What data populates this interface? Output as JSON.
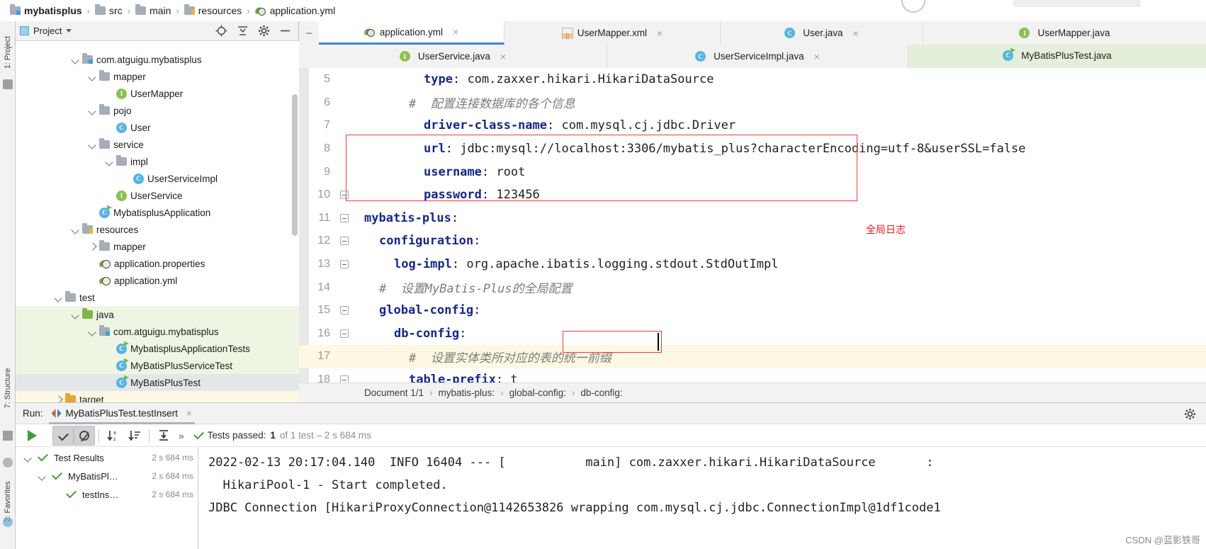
{
  "breadcrumb": {
    "items": [
      {
        "label": "mybatisplus",
        "icon": "module-folder-icon"
      },
      {
        "label": "src",
        "icon": "folder-icon"
      },
      {
        "label": "main",
        "icon": "folder-icon"
      },
      {
        "label": "resources",
        "icon": "resources-folder-icon"
      },
      {
        "label": "application.yml",
        "icon": "yaml-file-icon"
      }
    ],
    "separator": "›"
  },
  "project_panel": {
    "title": "Project",
    "actions": [
      "locate-icon",
      "collapse-all-icon",
      "gear-icon",
      "hide-icon"
    ],
    "tree": [
      {
        "label": "com.atguigu.mybatisplus",
        "icon": "package-icon",
        "indent": 3,
        "arrow": "down",
        "bg": "none"
      },
      {
        "label": "mapper",
        "icon": "folder-icon",
        "indent": 4,
        "arrow": "down",
        "bg": "none"
      },
      {
        "label": "UserMapper",
        "icon": "interface-icon",
        "indent": 5,
        "arrow": "none",
        "bg": "none"
      },
      {
        "label": "pojo",
        "icon": "folder-icon",
        "indent": 4,
        "arrow": "down",
        "bg": "none"
      },
      {
        "label": "User",
        "icon": "class-icon",
        "indent": 5,
        "arrow": "none",
        "bg": "none"
      },
      {
        "label": "service",
        "icon": "folder-icon",
        "indent": 4,
        "arrow": "down",
        "bg": "none"
      },
      {
        "label": "impl",
        "icon": "folder-icon",
        "indent": 5,
        "arrow": "down",
        "bg": "none"
      },
      {
        "label": "UserServiceImpl",
        "icon": "class-icon",
        "indent": 6,
        "arrow": "none",
        "bg": "none"
      },
      {
        "label": "UserService",
        "icon": "interface-icon",
        "indent": 5,
        "arrow": "none",
        "bg": "none"
      },
      {
        "label": "MybatisplusApplication",
        "icon": "runnable-class-icon",
        "indent": 4,
        "arrow": "none",
        "bg": "none"
      },
      {
        "label": "resources",
        "icon": "resources-folder-icon",
        "indent": 3,
        "arrow": "down",
        "bg": "none"
      },
      {
        "label": "mapper",
        "icon": "folder-icon",
        "indent": 4,
        "arrow": "right",
        "bg": "none"
      },
      {
        "label": "application.properties",
        "icon": "yaml-file-icon",
        "indent": 4,
        "arrow": "none",
        "bg": "none"
      },
      {
        "label": "application.yml",
        "icon": "yaml-file-icon",
        "indent": 4,
        "arrow": "none",
        "bg": "none"
      },
      {
        "label": "test",
        "icon": "folder-icon",
        "indent": 2,
        "arrow": "down",
        "bg": "none"
      },
      {
        "label": "java",
        "icon": "test-source-folder-icon",
        "indent": 3,
        "arrow": "down",
        "bg": "green"
      },
      {
        "label": "com.atguigu.mybatisplus",
        "icon": "package-icon",
        "indent": 4,
        "arrow": "down",
        "bg": "green"
      },
      {
        "label": "MybatisplusApplicationTests",
        "icon": "runnable-class-icon",
        "indent": 5,
        "arrow": "none",
        "bg": "green"
      },
      {
        "label": "MyBatisPlusServiceTest",
        "icon": "runnable-class-icon",
        "indent": 5,
        "arrow": "none",
        "bg": "green"
      },
      {
        "label": "MyBatisPlusTest",
        "icon": "runnable-class-icon",
        "indent": 5,
        "arrow": "none",
        "bg": "selected"
      },
      {
        "label": "target",
        "icon": "excluded-folder-icon",
        "indent": 2,
        "arrow": "right",
        "bg": "highlight"
      }
    ]
  },
  "editor_tabs": {
    "row1": [
      {
        "label": "application.yml",
        "icon": "yaml-file-icon",
        "state": "active-blue",
        "close": "×"
      },
      {
        "label": "UserMapper.xml",
        "icon": "xml-file-icon",
        "state": "inactive",
        "close": "×"
      },
      {
        "label": "User.java",
        "icon": "class-icon",
        "state": "inactive",
        "close": "×"
      },
      {
        "label": "UserMapper.java",
        "icon": "interface-icon",
        "state": "inactive",
        "close": ""
      }
    ],
    "row2": [
      {
        "label": "UserService.java",
        "icon": "interface-icon",
        "state": "inactive",
        "close": "×"
      },
      {
        "label": "UserServiceImpl.java",
        "icon": "class-icon",
        "state": "inactive",
        "close": "×"
      },
      {
        "label": "MyBatisPlusTest.java",
        "icon": "runnable-class-icon",
        "state": "active-green",
        "close": ""
      }
    ]
  },
  "code": {
    "lines": [
      {
        "num": "5",
        "indent": 4,
        "fold": "none",
        "segments": [
          {
            "t": "type",
            "c": "key"
          },
          {
            "t": ": ",
            "c": "plain"
          },
          {
            "t": "com.zaxxer.hikari.HikariDataSource",
            "c": "plain"
          }
        ]
      },
      {
        "num": "6",
        "indent": 3,
        "fold": "none",
        "segments": [
          {
            "t": "#  配置连接数据库的各个信息",
            "c": "comment"
          }
        ]
      },
      {
        "num": "7",
        "indent": 4,
        "fold": "none",
        "segments": [
          {
            "t": "driver-class-name",
            "c": "key"
          },
          {
            "t": ": ",
            "c": "plain"
          },
          {
            "t": "com.mysql.cj.jdbc.Driver",
            "c": "plain"
          }
        ]
      },
      {
        "num": "8",
        "indent": 4,
        "fold": "none",
        "segments": [
          {
            "t": "url",
            "c": "key"
          },
          {
            "t": ": ",
            "c": "plain"
          },
          {
            "t": "jdbc:mysql://localhost:3306/mybatis_plus?characterEncoding=utf-8&userSSL=false",
            "c": "plain"
          }
        ]
      },
      {
        "num": "9",
        "indent": 4,
        "fold": "none",
        "segments": [
          {
            "t": "username",
            "c": "key"
          },
          {
            "t": ": ",
            "c": "plain"
          },
          {
            "t": "root",
            "c": "plain"
          }
        ]
      },
      {
        "num": "10",
        "indent": 4,
        "fold": "mark",
        "segments": [
          {
            "t": "password",
            "c": "key"
          },
          {
            "t": ": ",
            "c": "plain"
          },
          {
            "t": "123456",
            "c": "plain"
          }
        ]
      },
      {
        "num": "11",
        "indent": 0,
        "fold": "arrow",
        "segments": [
          {
            "t": "mybatis-plus",
            "c": "key"
          },
          {
            "t": ":",
            "c": "plain"
          }
        ]
      },
      {
        "num": "12",
        "indent": 1,
        "fold": "mark",
        "segments": [
          {
            "t": "configuration",
            "c": "key"
          },
          {
            "t": ":",
            "c": "plain"
          }
        ]
      },
      {
        "num": "13",
        "indent": 2,
        "fold": "mark",
        "segments": [
          {
            "t": "log-impl",
            "c": "key"
          },
          {
            "t": ": ",
            "c": "plain"
          },
          {
            "t": "org.apache.ibatis.logging.stdout.StdOutImpl",
            "c": "plain"
          }
        ]
      },
      {
        "num": "14",
        "indent": 1,
        "fold": "none",
        "segments": [
          {
            "t": "#  设置MyBatis-Plus的全局配置",
            "c": "comment"
          }
        ]
      },
      {
        "num": "15",
        "indent": 1,
        "fold": "mark",
        "segments": [
          {
            "t": "global-config",
            "c": "key"
          },
          {
            "t": ":",
            "c": "plain"
          }
        ]
      },
      {
        "num": "16",
        "indent": 2,
        "fold": "mark",
        "segments": [
          {
            "t": "db-config",
            "c": "key"
          },
          {
            "t": ":",
            "c": "plain"
          }
        ]
      },
      {
        "num": "17",
        "indent": 3,
        "fold": "none",
        "highlight": true,
        "segments": [
          {
            "t": "#  设置实体类所对应的表的统一前缀",
            "c": "comment"
          }
        ]
      },
      {
        "num": "18",
        "indent": 3,
        "fold": "mark",
        "segments": [
          {
            "t": "table-prefix",
            "c": "key"
          },
          {
            "t": ": ",
            "c": "plain"
          },
          {
            "t": "t_",
            "c": "plain"
          }
        ]
      }
    ],
    "annotation_label": "全局日志"
  },
  "document_bar": {
    "items": [
      "Document 1/1",
      "mybatis-plus:",
      "global-config:",
      "db-config:"
    ],
    "separator": "›"
  },
  "run_panel": {
    "run_label": "Run:",
    "tab_label": "MyBatisPlusTest.testInsert",
    "tab_close": "×",
    "toolbar_icons": [
      "rerun-icon",
      "show-passed-icon",
      "show-ignored-icon",
      "sort-alphabetically-icon",
      "sort-by-duration-icon",
      "expand-collapse-icon",
      "more-icon"
    ],
    "chevron": "»",
    "status": {
      "prefix": "Tests passed:",
      "count": "1",
      "suffix": "of 1 test – 2 s 684 ms"
    },
    "tree": [
      {
        "label": "Test Results",
        "time": "2 s 684 ms",
        "indent": 0,
        "arrow": "down"
      },
      {
        "label": "MyBatisPl…",
        "time": "2 s 684 ms",
        "indent": 1,
        "arrow": "down"
      },
      {
        "label": "testIns…",
        "time": "2 s 684 ms",
        "indent": 2,
        "arrow": "none"
      }
    ],
    "console": [
      "2022-02-13 20:17:04.140  INFO 16404 --- [           main] com.zaxxer.hikari.HikariDataSource       :",
      "  HikariPool-1 - Start completed.",
      "JDBC Connection [HikariProxyConnection@1142653826 wrapping com.mysql.cj.jdbc.ConnectionImpl@1df1code1"
    ]
  },
  "rails": {
    "left_top": "1: Project",
    "left_structure": "7: Structure",
    "left_favorites": "2: Favorites"
  },
  "watermark": "CSDN @蓝影铁哥",
  "colors": {
    "accent_blue": "#3e86c9",
    "annotation_red": "#ee3b3b",
    "keyword": "#17268c",
    "comment": "#7d7d7d",
    "test_green": "#eff5e3"
  }
}
